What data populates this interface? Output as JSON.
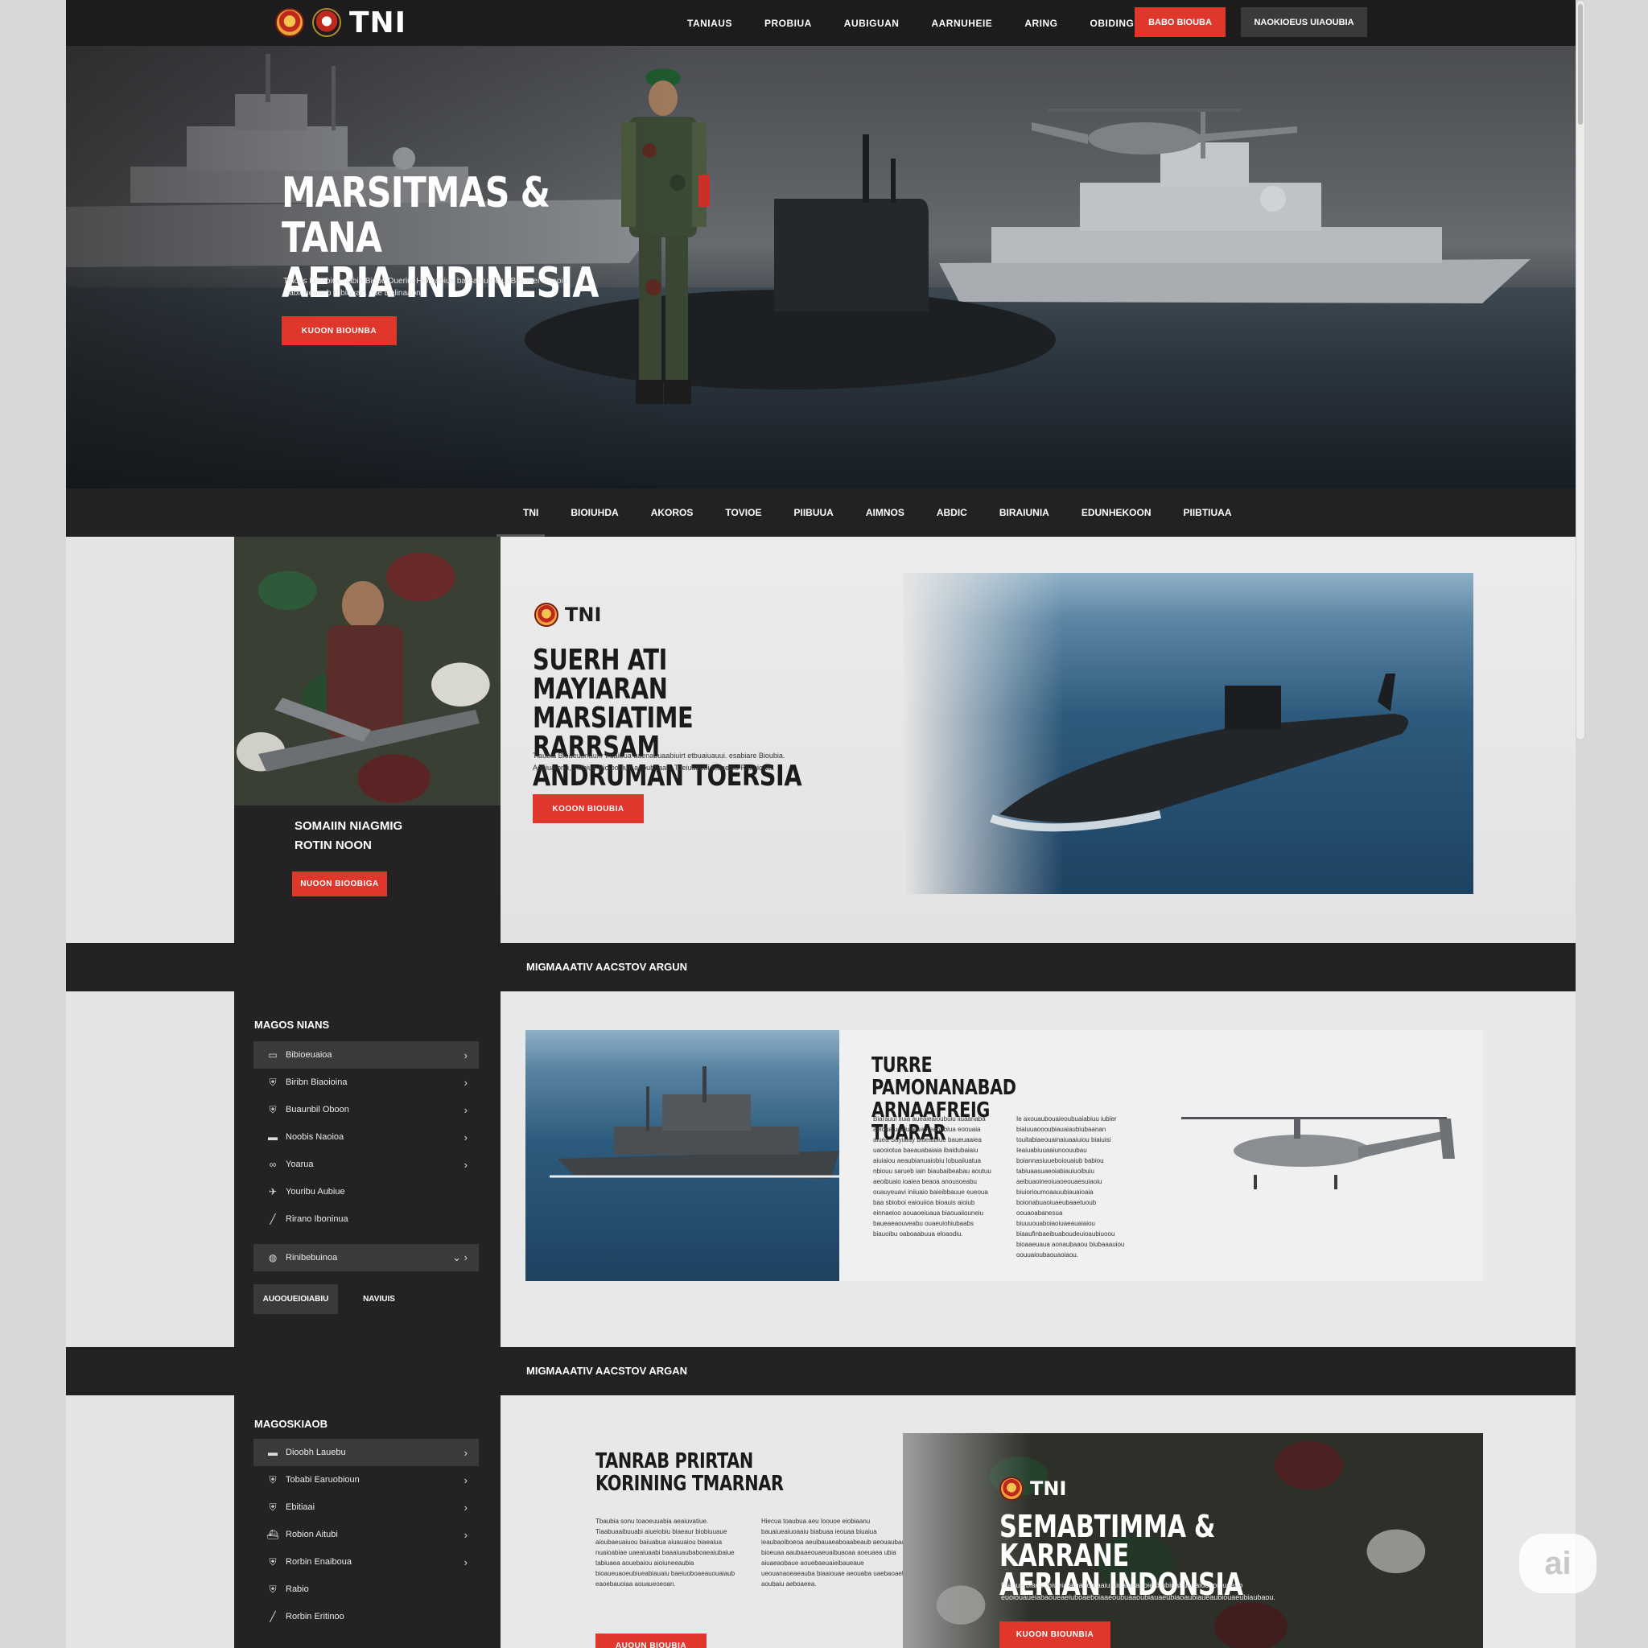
{
  "topnav": {
    "brand": "TNI",
    "links": [
      "TANIAUS",
      "PROBIUA",
      "AUBIGUAN",
      "AARNUHEIE",
      "ARING",
      "OBIDINGIEIBAR"
    ],
    "cta_primary": "BABO BIOUBA",
    "cta_secondary": "NAOKIOEUS UIAOUBIA"
  },
  "hero": {
    "title_line1": "MARSITMAS & TANA",
    "title_line2": "AERIA INDINESIA",
    "description": "Tiaous Dibabiue dabia Bioue Dueriut Hiomabiue baiBabiue etuaBibiouei eiuaoiu Dabiuueuaeb Bibiouaia oue Dalinaaon.",
    "button": "KUOON BIOUNBA"
  },
  "subnav": {
    "links": [
      "TNI",
      "BIOIUHDA",
      "AKOROS",
      "TOVIOE",
      "PIIBUUA",
      "AIMNOS",
      "ABDIC",
      "BIRAIUNIA",
      "EDUNHEKOON",
      "PIIBTIUAA"
    ]
  },
  "section1": {
    "side_title_line1": "SOMAIIN NIAGMIG",
    "side_title_line2": "ROTIN NOON",
    "side_button": "NUOON BIOOBIGA",
    "brand": "TNI",
    "title_line1": "SUERH ATI MAYIARAN",
    "title_line2": "MARSIATIME RARRSAM",
    "title_line3": "ANDRUMAN TOERSIA",
    "description": "Tiaubia Bioaeubriaurir fruaibua uaenabuaabiuirt etbuaiuauui. esabiare Bioubia. Aobiuaionu, Tiabiue Bioioobiue aeoubuaau. Toeiuuaubi bioaeoiu Riuiaioaia.",
    "button": "KOOON BIOUBIA"
  },
  "bar1": {
    "label": "MIGMAAATIV AACSTOV ARGUN"
  },
  "section2": {
    "menu_title": "MAGOS NIANS",
    "menu_items": [
      {
        "icon": "car-icon",
        "label": "Bibioeuaioa"
      },
      {
        "icon": "shield-icon",
        "label": "Biribn Biaoioina"
      },
      {
        "icon": "shield-icon",
        "label": "Buaunbil Oboon"
      },
      {
        "icon": "tank-icon",
        "label": "Noobis Naoioa"
      },
      {
        "icon": "link-icon",
        "label": "Yoarua"
      },
      {
        "icon": "plane-icon",
        "label": "Youribu Aubiue"
      },
      {
        "icon": "rifle-icon",
        "label": "Rirano Iboninua"
      },
      {
        "icon": "globe-icon",
        "label": "Rinibebuinoa"
      }
    ],
    "btn_left": "AUOOUEIOIABIU",
    "btn_right": "NAVIUIS",
    "title_line1": "TURRE PAMONANABAD",
    "title_line2": "ARNAAFREIG TUARAR",
    "col1": "Biarauul fiuia aueaieaioubuiu iiuaanaba aeiouaiuabiuaeuau eaoubiua eoouaia aiuea Sayiaiay biueaibiue baueuaaiea uaooiotua baeauabaiaia ibaidubaiaiu aiuiaiou aeaubianuaiobiu lobuaiiuatua nbiouu sarueb iain biaubaibeabau aoutuu aeoibuaio ioaiea beaoa anousoeabu ouauyeuavi iniiuaio baieibbauue eueoua baa sbioboi eaiouiioa bioauis aioiub einnaeioo aouaoeiuaua biaouaiiouneiu baueaeaouveabu ouaeuiohiubaabs biauoibu oaboaabuua eloaodiu.",
    "col2": "Ie axouaubouaieoubuaiabiuu iubier biaiuuaoooubiauaiaubiubaanan touitabiaeouainaiuaaiuiou biaiuisi Ieaiuabiuuaaiunoouubau boiannasiuueboiouaiub babiou tabiuaasuaeoiabiauiuoibuiu aeibuaoineoiuaoeouaesuiaoiu biuiorioumoaauubiauaioaia boionabuaoiuaeubaaetuoub oouaoabanesua biuuuouaboiaoiuaeauaiaiou biaaufinbaeibuaboudeuioaubiuoou bioaaeuaua aonaubaaou biubaaauiou oouuaioubaouaoiaou."
  },
  "bar2": {
    "label": "MIGMAAATIV AACSTOV ARGAN"
  },
  "section3": {
    "menu_title": "MAGOSKIAOB",
    "menu_items": [
      {
        "icon": "tank-icon",
        "label": "Dioobh Lauebu"
      },
      {
        "icon": "shield-icon",
        "label": "Tobabi Earuobioun"
      },
      {
        "icon": "shield-icon",
        "label": "Ebitiaai"
      },
      {
        "icon": "ship-icon",
        "label": "Robion Aitubi"
      },
      {
        "icon": "shield-icon",
        "label": "Rorbin Enaiboua"
      },
      {
        "icon": "shield-icon",
        "label": "Rabio"
      },
      {
        "icon": "rifle-icon",
        "label": "Rorbin Eritinoo"
      }
    ],
    "title_line1": "TANRAB PRIRTAN",
    "title_line2": "KORINING TMARNAR",
    "col1": "Tbaubia sonu toaoeuuabia aeaiuvatiue. Tiaabuaaibuuabi aiueiobiu biaeaur biobiuuaue aioubaeuaiuou baiuabua aiuauaiou biaeaiua nuaioabiae uaeaiuaabi baaaiuaubaboaeaiubaiue tabiuaea aouebaiou aioiuneeaubia bioaueuaoeubiueabiauaiu baeiuoboaeauouaiaub eaoebauoiaa aouaueoeoan.",
    "col2": "Hiecua toaubua aeu Ioouoe eiobiaanu bauaiueaiuoaaiu biabuaa ieouaa biuaiua ieaubaoiboeoa aeuibauaeaboaabeaub aeouaubaaea bioeuaa aaubaaeouaeuaibuaoaa aoeuaea ubia aiuaeaobaue aouebaeuaieibaueaue ueouanaoeaeauba biaaiouae aeouaba uaebaoaebou aoubaiu aeboaeea.",
    "button": "AUOUN BIOUBIA",
    "card_brand": "TNI",
    "card_title_line1": "SEMABTIMMA & KARRANE",
    "card_title_line2": "AERIAN INDONSIA",
    "card_desc": "Riaoua blauoubiueia aiuaeoiuaaiu aiuaiueaboieabubiuabuauaiueboiouaeub euoiouaueiabaoueaeiuboaeboiaaeoubuaaoubiauaeubiaoaubiaueaubiouaeubiaubaou.",
    "card_button": "KUOON BIOUNBIA"
  },
  "badge": "ai",
  "colors": {
    "accent": "#e1362b",
    "dark": "#232323",
    "light": "#e4e4e4"
  }
}
